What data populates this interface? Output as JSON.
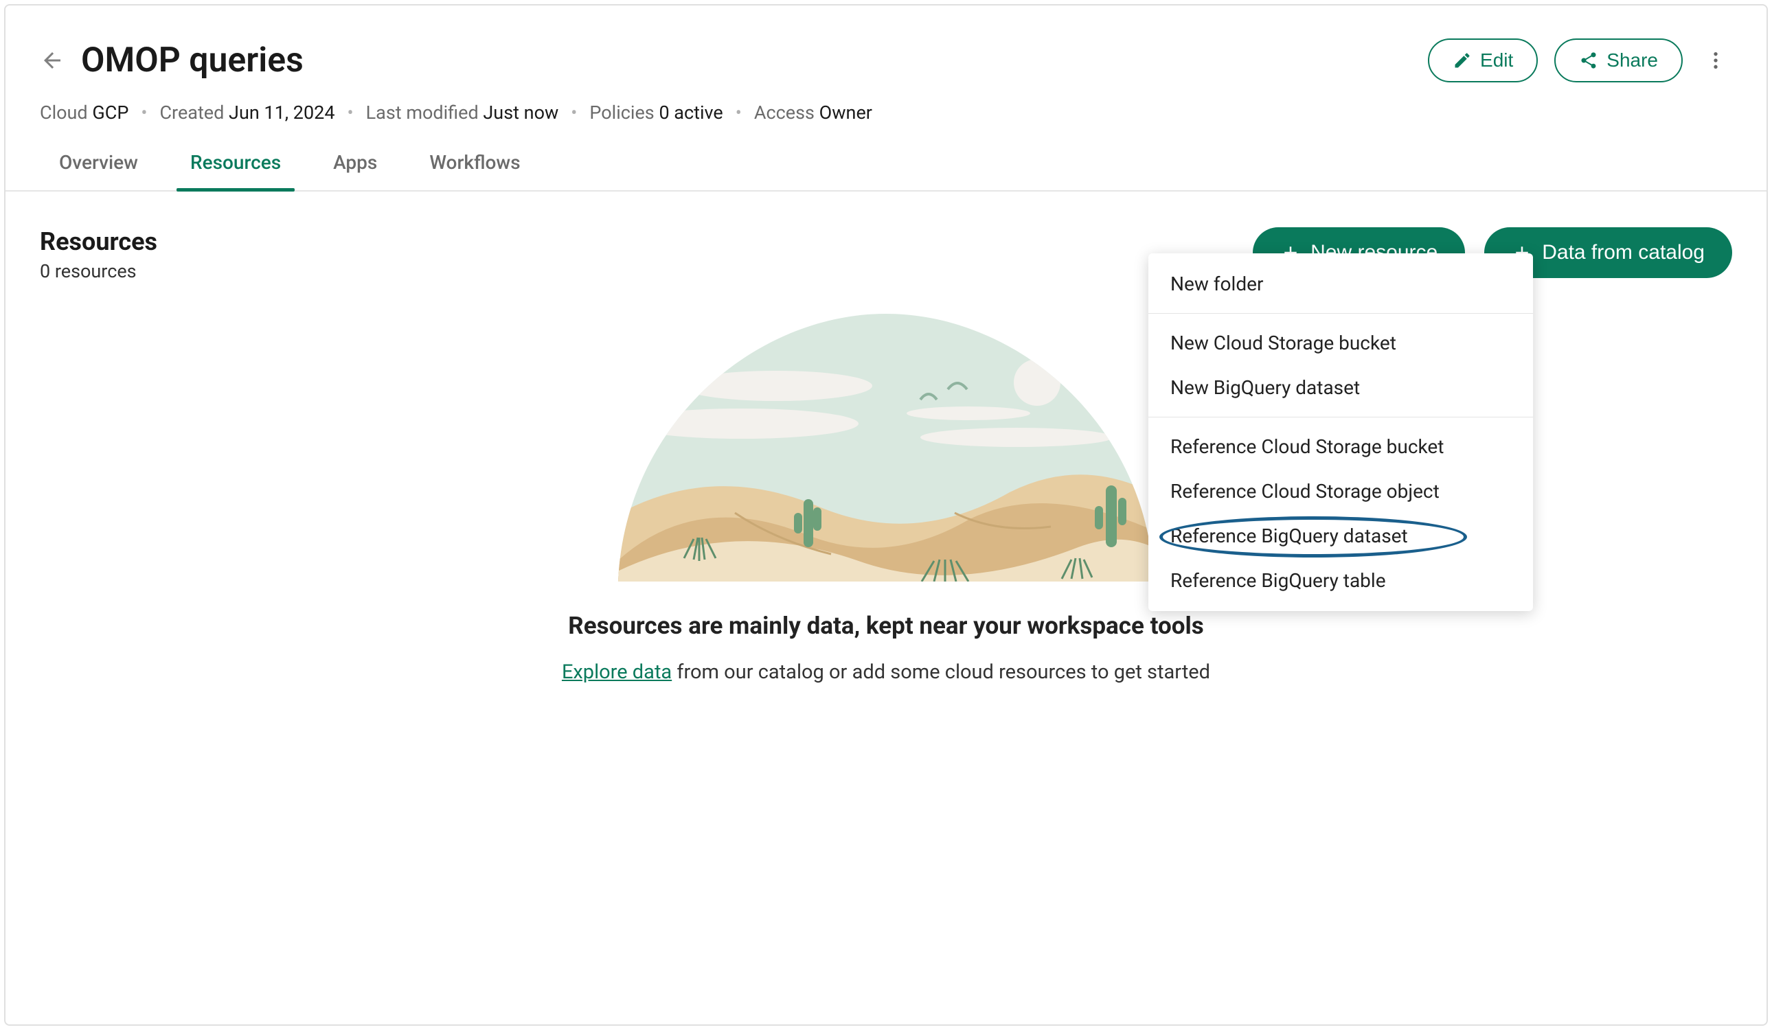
{
  "header": {
    "title": "OMOP queries",
    "edit_label": "Edit",
    "share_label": "Share"
  },
  "meta": {
    "cloud_label": "Cloud",
    "cloud_value": "GCP",
    "created_label": "Created",
    "created_value": "Jun 11, 2024",
    "modified_label": "Last modified",
    "modified_value": "Just now",
    "policies_label": "Policies",
    "policies_value": "0 active",
    "access_label": "Access",
    "access_value": "Owner"
  },
  "tabs": {
    "overview": "Overview",
    "resources": "Resources",
    "apps": "Apps",
    "workflows": "Workflows"
  },
  "resources": {
    "heading": "Resources",
    "count_text": "0 resources",
    "new_resource_label": "New resource",
    "data_catalog_label": "Data from catalog"
  },
  "dropdown": {
    "group1": [
      "New folder"
    ],
    "group2": [
      "New Cloud Storage bucket",
      "New BigQuery dataset"
    ],
    "group3": [
      "Reference Cloud Storage bucket",
      "Reference Cloud Storage object",
      "Reference BigQuery dataset",
      "Reference BigQuery table"
    ]
  },
  "empty": {
    "heading": "Resources are mainly data, kept near your workspace tools",
    "link_text": "Explore data",
    "sub_text": " from our catalog or add some cloud resources to get started"
  }
}
